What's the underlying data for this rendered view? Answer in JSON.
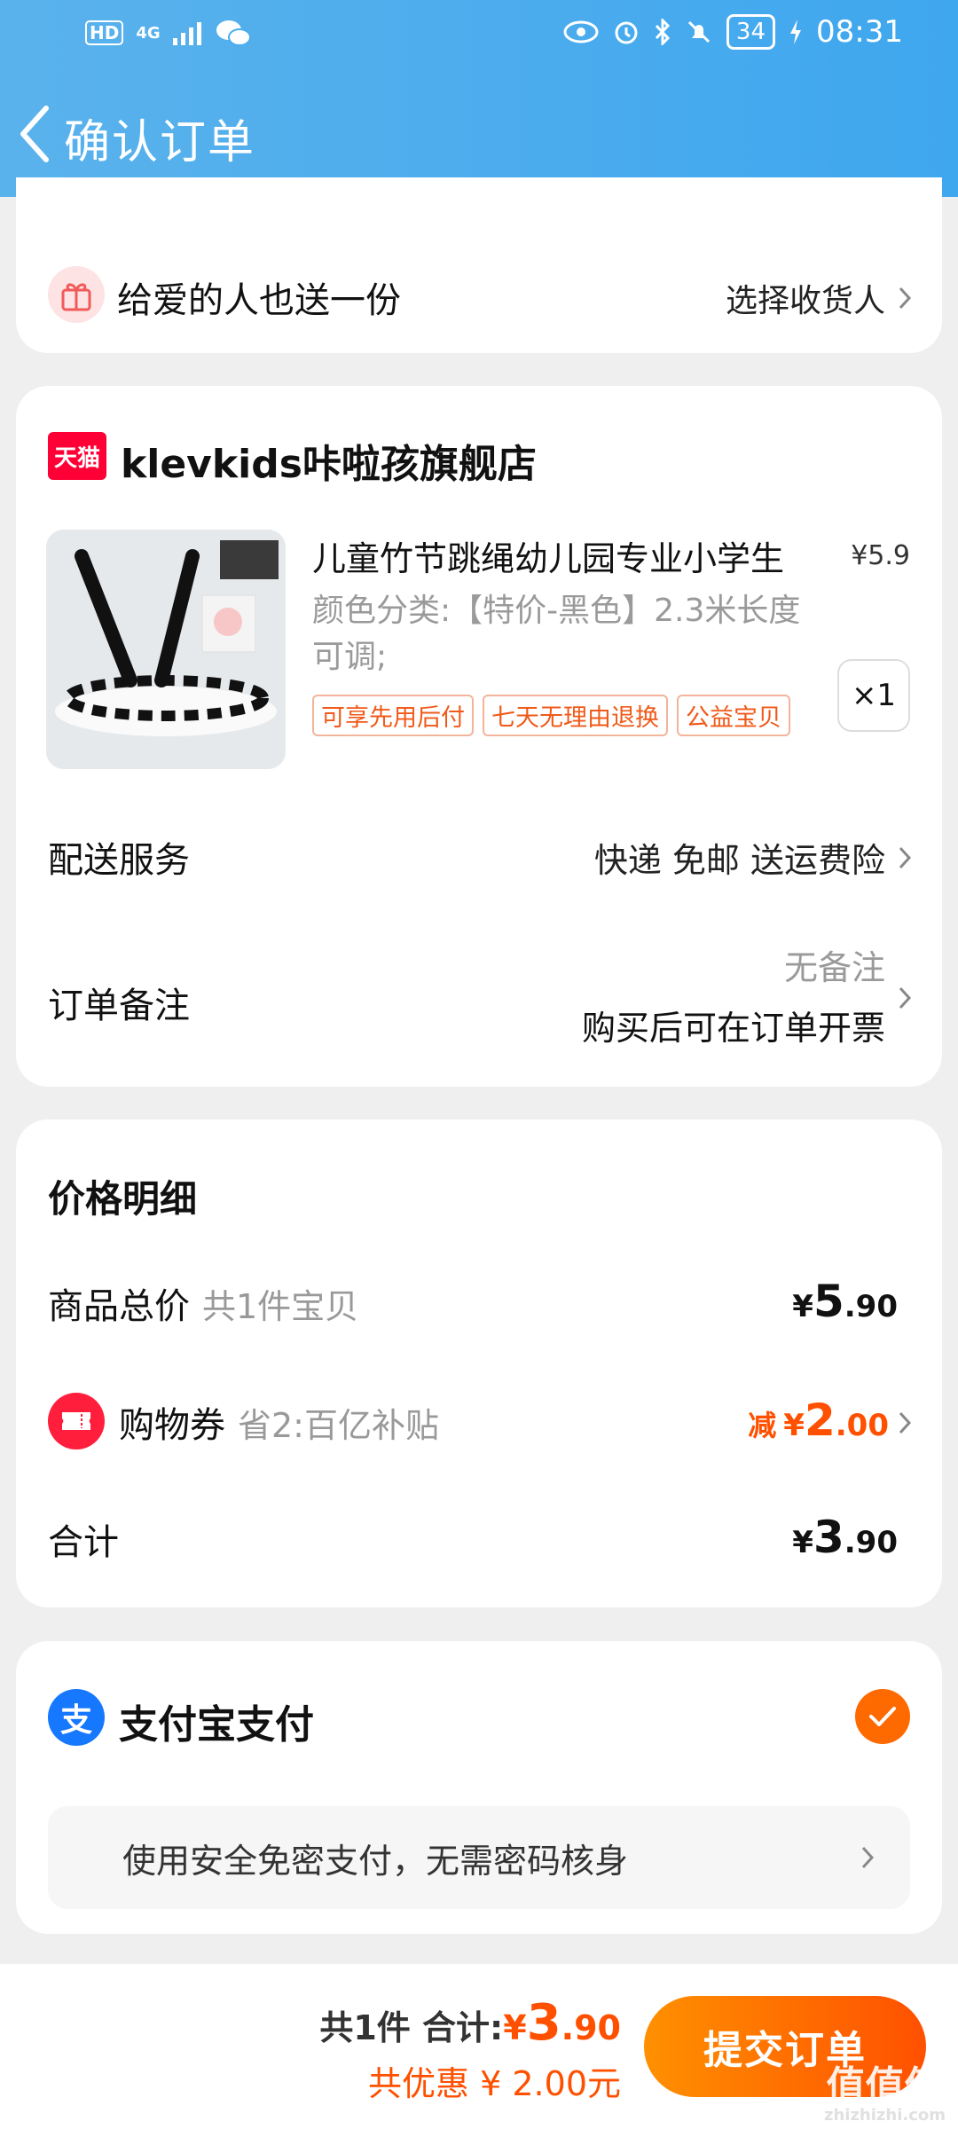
{
  "status_bar": {
    "hd": "HD",
    "net": "4G",
    "battery": "34",
    "time": "08:31"
  },
  "header": {
    "title": "确认订单"
  },
  "gift": {
    "label": "给爱的人也送一份",
    "action": "选择收货人"
  },
  "shop": {
    "badge": "天猫",
    "name": "klevkids咔啦孩旗舰店",
    "product": {
      "title": "儿童竹节跳绳幼儿园专业小学生",
      "price": "¥5.9",
      "spec": "颜色分类:【特价-黑色】2.3米长度可调;",
      "tags": [
        "可享先用后付",
        "七天无理由退换",
        "公益宝贝"
      ],
      "quantity": "×1"
    },
    "delivery": {
      "label": "配送服务",
      "value": "快递 免邮 送运费险"
    },
    "note": {
      "label": "订单备注",
      "value": "无备注",
      "sub": "购买后可在订单开票"
    }
  },
  "price_detail": {
    "title": "价格明细",
    "subtotal": {
      "label": "商品总价",
      "sub": "共1件宝贝",
      "currency": "¥",
      "int": "5",
      "dec": ".90"
    },
    "coupon": {
      "label": "购物券",
      "sub": "省2:百亿补贴",
      "prefix": "减",
      "currency": "¥",
      "int": "2",
      "dec": ".00"
    },
    "total": {
      "label": "合计",
      "currency": "¥",
      "int": "3",
      "dec": ".90"
    }
  },
  "payment": {
    "name": "支付宝支付",
    "hint": "使用安全免密支付，无需密码核身"
  },
  "bottom": {
    "count": "共1件",
    "total_label": "合计:",
    "currency": "¥",
    "int": "3",
    "dec": ".90",
    "discount": "共优惠 ¥ 2.00元",
    "submit": "提交订单"
  },
  "watermark": {
    "text": "值值值",
    "url": "zhizhizhi.com"
  },
  "colors": {
    "header": "#3fa7ee",
    "accent": "#ff5000",
    "tmall": "#ff0036",
    "alipay": "#1677ff"
  }
}
